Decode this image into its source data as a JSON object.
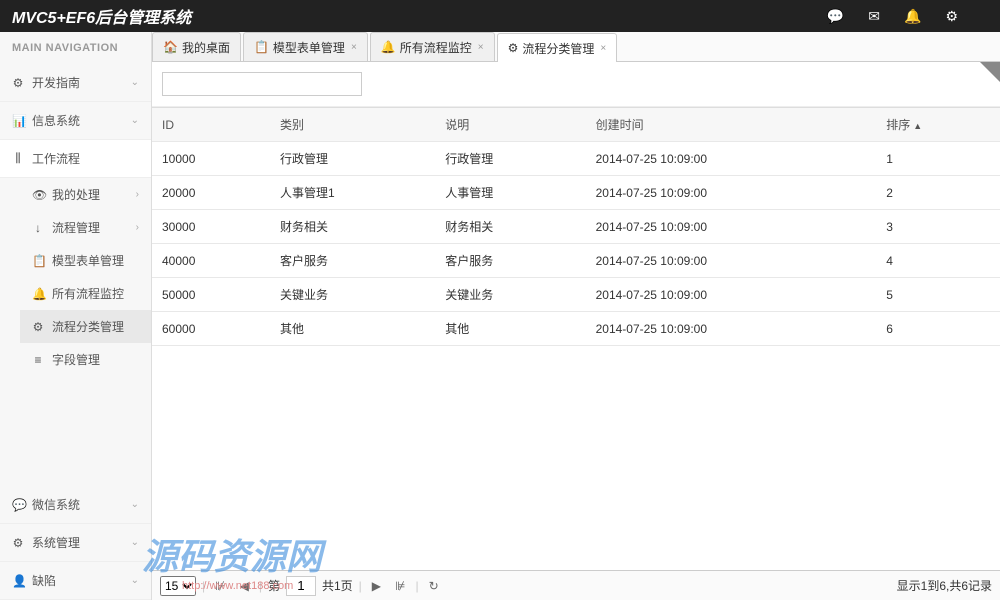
{
  "header": {
    "title": "MVC5+EF6后台管理系统"
  },
  "sidebar": {
    "heading": "MAIN NAVIGATION",
    "top_items": [
      {
        "icon": "⚙",
        "label": "开发指南"
      },
      {
        "icon": "📊",
        "label": "信息系统"
      }
    ],
    "workflow": {
      "icon": "⫼",
      "label": "工作流程"
    },
    "workflow_sub": [
      {
        "icon": "👁",
        "label": "我的处理",
        "expandable": true
      },
      {
        "icon": "↓",
        "label": "流程管理",
        "expandable": true
      }
    ],
    "workflow_mgmt": [
      {
        "icon": "📋",
        "label": "模型表单管理"
      },
      {
        "icon": "🔔",
        "label": "所有流程监控"
      },
      {
        "icon": "⚙",
        "label": "流程分类管理",
        "active": true
      },
      {
        "icon": "≡",
        "label": "字段管理"
      }
    ],
    "bottom_items": [
      {
        "icon": "💬",
        "label": "微信系统"
      },
      {
        "icon": "⚙",
        "label": "系统管理"
      },
      {
        "icon": "👤",
        "label": "缺陷"
      }
    ]
  },
  "tabs": [
    {
      "icon": "🏠",
      "label": "我的桌面"
    },
    {
      "icon": "📋",
      "label": "模型表单管理",
      "closable": true
    },
    {
      "icon": "🔔",
      "label": "所有流程监控",
      "closable": true
    },
    {
      "icon": "⚙",
      "label": "流程分类管理",
      "closable": true,
      "active": true
    }
  ],
  "table": {
    "headers": [
      "ID",
      "类别",
      "说明",
      "创建时间",
      "排序"
    ],
    "sort_col": 4,
    "rows": [
      [
        "10000",
        "行政管理",
        "行政管理",
        "2014-07-25 10:09:00",
        "1"
      ],
      [
        "20000",
        "人事管理1",
        "人事管理",
        "2014-07-25 10:09:00",
        "2"
      ],
      [
        "30000",
        "财务相关",
        "财务相关",
        "2014-07-25 10:09:00",
        "3"
      ],
      [
        "40000",
        "客户服务",
        "客户服务",
        "2014-07-25 10:09:00",
        "4"
      ],
      [
        "50000",
        "关键业务",
        "关键业务",
        "2014-07-25 10:09:00",
        "5"
      ],
      [
        "60000",
        "其他",
        "其他",
        "2014-07-25 10:09:00",
        "6"
      ]
    ]
  },
  "pager": {
    "page_size": "15",
    "page_label_prefix": "第",
    "page_input": "1",
    "total_pages": "共1页",
    "summary": "显示1到6,共6记录"
  },
  "watermark": {
    "text": "源码资源网",
    "url": "http://www.net188.com"
  }
}
